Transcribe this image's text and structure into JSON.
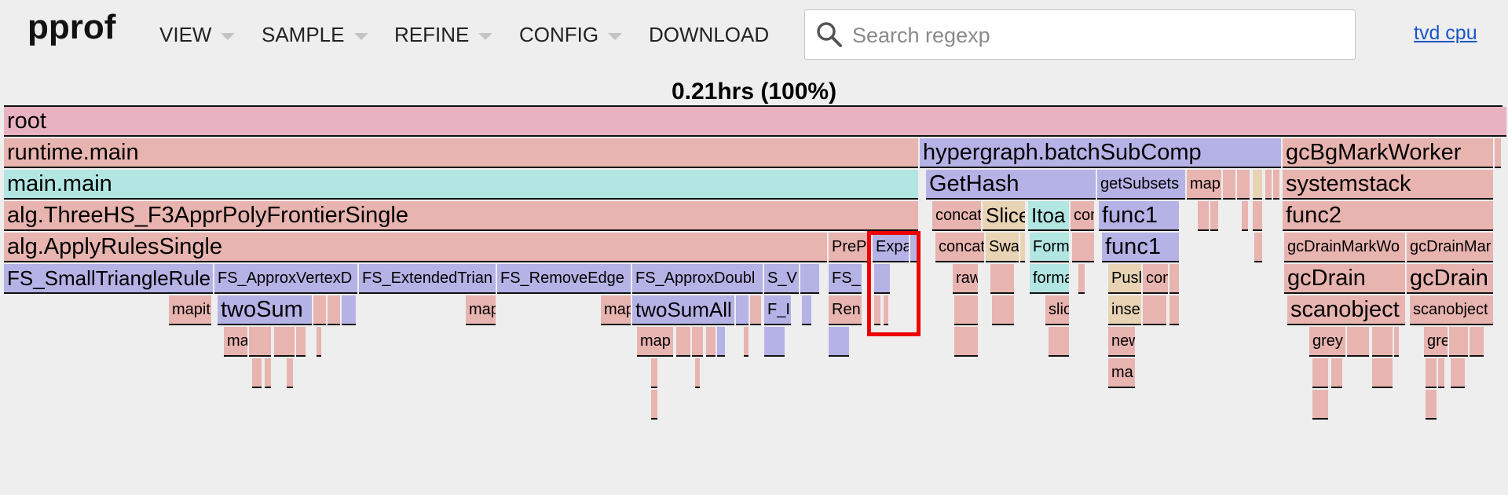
{
  "header": {
    "logo": "pprof",
    "menus": [
      {
        "label": "VIEW"
      },
      {
        "label": "SAMPLE"
      },
      {
        "label": "REFINE"
      },
      {
        "label": "CONFIG"
      },
      {
        "label": "DOWNLOAD"
      }
    ],
    "search": {
      "placeholder": "Search regexp",
      "value": ""
    },
    "user_link": "tvd cpu"
  },
  "flamegraph": {
    "total_label": "0.21hrs (100%)",
    "colors": {
      "pink": "#e8b2c0",
      "salmon": "#e8b4b0",
      "cyan": "#b2e6e2",
      "purple": "#b5b2e6",
      "tan": "#e8d4b4"
    },
    "frames": [
      {
        "label": "root",
        "row": 0,
        "start": 0,
        "end": 1913,
        "color": "pink",
        "size": "big"
      },
      {
        "label": "runtime.main",
        "row": 1,
        "start": 0,
        "end": 1164,
        "color": "salmon",
        "size": "big"
      },
      {
        "label": "hypergraph.batchSubComp",
        "row": 1,
        "start": 1166,
        "end": 1626,
        "color": "purple",
        "size": "big"
      },
      {
        "label": "gcBgMarkWorker",
        "row": 1,
        "start": 1628,
        "end": 1896,
        "color": "salmon",
        "size": "big"
      },
      {
        "label": "",
        "row": 1,
        "start": 1898,
        "end": 1906,
        "color": "salmon",
        "size": "big"
      },
      {
        "label": "main.main",
        "row": 2,
        "start": 0,
        "end": 1164,
        "color": "cyan",
        "size": "big"
      },
      {
        "label": "GetHash",
        "row": 2,
        "start": 1174,
        "end": 1390,
        "color": "purple",
        "size": "big"
      },
      {
        "label": "getSubsets",
        "row": 2,
        "start": 1392,
        "end": 1504,
        "color": "purple",
        "size": "small"
      },
      {
        "label": "map",
        "row": 2,
        "start": 1506,
        "end": 1550,
        "color": "salmon",
        "size": "small"
      },
      {
        "label": "",
        "row": 2,
        "start": 1552,
        "end": 1568,
        "color": "salmon",
        "size": "small"
      },
      {
        "label": "",
        "row": 2,
        "start": 1570,
        "end": 1586,
        "color": "salmon",
        "size": "small"
      },
      {
        "label": "",
        "row": 2,
        "start": 1590,
        "end": 1602,
        "color": "tan",
        "size": "small"
      },
      {
        "label": "",
        "row": 2,
        "start": 1606,
        "end": 1614,
        "color": "salmon",
        "size": "small"
      },
      {
        "label": "",
        "row": 2,
        "start": 1616,
        "end": 1624,
        "color": "salmon",
        "size": "small"
      },
      {
        "label": "systemstack",
        "row": 2,
        "start": 1628,
        "end": 1896,
        "color": "salmon",
        "size": "big"
      },
      {
        "label": "alg.ThreeHS_F3ApprPolyFrontierSingle",
        "row": 3,
        "start": 0,
        "end": 1164,
        "color": "salmon",
        "size": "big"
      },
      {
        "label": "concat",
        "row": 3,
        "start": 1182,
        "end": 1244,
        "color": "salmon",
        "size": "small"
      },
      {
        "label": "Slice",
        "row": 3,
        "start": 1246,
        "end": 1300,
        "color": "tan",
        "size": "mid"
      },
      {
        "label": "Itoa",
        "row": 3,
        "start": 1304,
        "end": 1356,
        "color": "cyan",
        "size": "mid"
      },
      {
        "label": "con",
        "row": 3,
        "start": 1358,
        "end": 1388,
        "color": "salmon",
        "size": "small"
      },
      {
        "label": "func1",
        "row": 3,
        "start": 1394,
        "end": 1496,
        "color": "purple",
        "size": "big"
      },
      {
        "label": "",
        "row": 3,
        "start": 1520,
        "end": 1534,
        "color": "salmon",
        "size": "small"
      },
      {
        "label": "",
        "row": 3,
        "start": 1536,
        "end": 1546,
        "color": "salmon",
        "size": "small"
      },
      {
        "label": "",
        "row": 3,
        "start": 1576,
        "end": 1584,
        "color": "salmon",
        "size": "small"
      },
      {
        "label": "",
        "row": 3,
        "start": 1590,
        "end": 1602,
        "color": "salmon",
        "size": "small"
      },
      {
        "label": "func2",
        "row": 3,
        "start": 1628,
        "end": 1896,
        "color": "salmon",
        "size": "big"
      },
      {
        "label": "alg.ApplyRulesSingle",
        "row": 4,
        "start": 0,
        "end": 1048,
        "color": "salmon",
        "size": "big"
      },
      {
        "label": "PreP",
        "row": 4,
        "start": 1050,
        "end": 1104,
        "color": "salmon",
        "size": "small"
      },
      {
        "label": "Expa",
        "row": 4,
        "start": 1106,
        "end": 1152,
        "color": "purple",
        "size": "small"
      },
      {
        "label": "",
        "row": 4,
        "start": 1154,
        "end": 1162,
        "color": "purple",
        "size": "small"
      },
      {
        "label": "concat",
        "row": 4,
        "start": 1186,
        "end": 1248,
        "color": "salmon",
        "size": "small"
      },
      {
        "label": "Swa",
        "row": 4,
        "start": 1250,
        "end": 1292,
        "color": "tan",
        "size": "small"
      },
      {
        "label": "",
        "row": 4,
        "start": 1294,
        "end": 1300,
        "color": "tan",
        "size": "small"
      },
      {
        "label": "Form",
        "row": 4,
        "start": 1306,
        "end": 1356,
        "color": "cyan",
        "size": "small"
      },
      {
        "label": "",
        "row": 4,
        "start": 1360,
        "end": 1388,
        "color": "salmon",
        "size": "small"
      },
      {
        "label": "func1",
        "row": 4,
        "start": 1398,
        "end": 1496,
        "color": "purple",
        "size": "big"
      },
      {
        "label": "",
        "row": 4,
        "start": 1592,
        "end": 1602,
        "color": "salmon",
        "size": "small"
      },
      {
        "label": "gcDrainMarkWo",
        "row": 4,
        "start": 1630,
        "end": 1784,
        "color": "salmon",
        "size": "small"
      },
      {
        "label": "gcDrainMar",
        "row": 4,
        "start": 1786,
        "end": 1896,
        "color": "salmon",
        "size": "small"
      },
      {
        "label": "FS_SmallTriangleRule",
        "row": 5,
        "start": 0,
        "end": 266,
        "color": "purple",
        "size": "mid"
      },
      {
        "label": "FS_ApproxVertexD",
        "row": 5,
        "start": 268,
        "end": 450,
        "color": "purple",
        "size": "small"
      },
      {
        "label": "FS_ExtendedTrian",
        "row": 5,
        "start": 452,
        "end": 626,
        "color": "purple",
        "size": "small"
      },
      {
        "label": "FS_RemoveEdge",
        "row": 5,
        "start": 628,
        "end": 798,
        "color": "purple",
        "size": "small"
      },
      {
        "label": "FS_ApproxDoubl",
        "row": 5,
        "start": 800,
        "end": 966,
        "color": "purple",
        "size": "small"
      },
      {
        "label": "S_V",
        "row": 5,
        "start": 968,
        "end": 1012,
        "color": "purple",
        "size": "small"
      },
      {
        "label": "",
        "row": 5,
        "start": 1014,
        "end": 1038,
        "color": "purple",
        "size": "small"
      },
      {
        "label": "FS_",
        "row": 5,
        "start": 1050,
        "end": 1092,
        "color": "purple",
        "size": "small"
      },
      {
        "label": "",
        "row": 5,
        "start": 1108,
        "end": 1128,
        "color": "purple",
        "size": "small"
      },
      {
        "label": "raw",
        "row": 5,
        "start": 1208,
        "end": 1240,
        "color": "salmon",
        "size": "small"
      },
      {
        "label": "",
        "row": 5,
        "start": 1256,
        "end": 1286,
        "color": "salmon",
        "size": "small"
      },
      {
        "label": "forma",
        "row": 5,
        "start": 1306,
        "end": 1356,
        "color": "cyan",
        "size": "small"
      },
      {
        "label": "",
        "row": 5,
        "start": 1368,
        "end": 1376,
        "color": "salmon",
        "size": "small"
      },
      {
        "label": "Push",
        "row": 5,
        "start": 1406,
        "end": 1448,
        "color": "tan",
        "size": "small"
      },
      {
        "label": "con",
        "row": 5,
        "start": 1450,
        "end": 1482,
        "color": "salmon",
        "size": "small"
      },
      {
        "label": "",
        "row": 5,
        "start": 1484,
        "end": 1496,
        "color": "salmon",
        "size": "small"
      },
      {
        "label": "gcDrain",
        "row": 5,
        "start": 1630,
        "end": 1784,
        "color": "salmon",
        "size": "big"
      },
      {
        "label": "gcDrain",
        "row": 5,
        "start": 1786,
        "end": 1896,
        "color": "salmon",
        "size": "big"
      },
      {
        "label": "mapit",
        "row": 6,
        "start": 210,
        "end": 264,
        "color": "salmon",
        "size": "small"
      },
      {
        "label": "twoSum",
        "row": 6,
        "start": 272,
        "end": 392,
        "color": "purple",
        "size": "big"
      },
      {
        "label": "",
        "row": 6,
        "start": 394,
        "end": 410,
        "color": "salmon",
        "size": "small"
      },
      {
        "label": "",
        "row": 6,
        "start": 412,
        "end": 428,
        "color": "salmon",
        "size": "small"
      },
      {
        "label": "",
        "row": 6,
        "start": 430,
        "end": 448,
        "color": "purple",
        "size": "small"
      },
      {
        "label": "map",
        "row": 6,
        "start": 588,
        "end": 626,
        "color": "salmon",
        "size": "small"
      },
      {
        "label": "map",
        "row": 6,
        "start": 760,
        "end": 798,
        "color": "salmon",
        "size": "small"
      },
      {
        "label": "twoSumAll",
        "row": 6,
        "start": 800,
        "end": 930,
        "color": "purple",
        "size": "mid"
      },
      {
        "label": "",
        "row": 6,
        "start": 932,
        "end": 948,
        "color": "purple",
        "size": "small"
      },
      {
        "label": "",
        "row": 6,
        "start": 950,
        "end": 964,
        "color": "salmon",
        "size": "small"
      },
      {
        "label": "F_I",
        "row": 6,
        "start": 968,
        "end": 1002,
        "color": "purple",
        "size": "small"
      },
      {
        "label": "",
        "row": 6,
        "start": 1016,
        "end": 1028,
        "color": "purple",
        "size": "small"
      },
      {
        "label": "Ren",
        "row": 6,
        "start": 1050,
        "end": 1092,
        "color": "salmon",
        "size": "small"
      },
      {
        "label": "",
        "row": 6,
        "start": 1108,
        "end": 1116,
        "color": "salmon",
        "size": "small"
      },
      {
        "label": "",
        "row": 6,
        "start": 1120,
        "end": 1126,
        "color": "salmon",
        "size": "small"
      },
      {
        "label": "",
        "row": 6,
        "start": 1210,
        "end": 1240,
        "color": "salmon",
        "size": "small"
      },
      {
        "label": "",
        "row": 6,
        "start": 1258,
        "end": 1286,
        "color": "salmon",
        "size": "small"
      },
      {
        "label": "slic",
        "row": 6,
        "start": 1326,
        "end": 1356,
        "color": "salmon",
        "size": "small"
      },
      {
        "label": "inse",
        "row": 6,
        "start": 1406,
        "end": 1448,
        "color": "tan",
        "size": "small"
      },
      {
        "label": "",
        "row": 6,
        "start": 1450,
        "end": 1480,
        "color": "salmon",
        "size": "small"
      },
      {
        "label": "",
        "row": 6,
        "start": 1484,
        "end": 1496,
        "color": "salmon",
        "size": "small"
      },
      {
        "label": "scanobject",
        "row": 6,
        "start": 1634,
        "end": 1784,
        "color": "salmon",
        "size": "big"
      },
      {
        "label": "scanobject",
        "row": 6,
        "start": 1790,
        "end": 1896,
        "color": "salmon",
        "size": "small"
      },
      {
        "label": "ma",
        "row": 7,
        "start": 280,
        "end": 310,
        "color": "salmon",
        "size": "small"
      },
      {
        "label": "",
        "row": 7,
        "start": 312,
        "end": 340,
        "color": "salmon",
        "size": "small"
      },
      {
        "label": "",
        "row": 7,
        "start": 344,
        "end": 370,
        "color": "salmon",
        "size": "small"
      },
      {
        "label": "",
        "row": 7,
        "start": 372,
        "end": 384,
        "color": "salmon",
        "size": "small"
      },
      {
        "label": "",
        "row": 7,
        "start": 398,
        "end": 404,
        "color": "salmon",
        "size": "small"
      },
      {
        "label": "map",
        "row": 7,
        "start": 806,
        "end": 852,
        "color": "salmon",
        "size": "small"
      },
      {
        "label": "",
        "row": 7,
        "start": 856,
        "end": 874,
        "color": "salmon",
        "size": "small"
      },
      {
        "label": "",
        "row": 7,
        "start": 876,
        "end": 890,
        "color": "salmon",
        "size": "small"
      },
      {
        "label": "",
        "row": 7,
        "start": 894,
        "end": 906,
        "color": "salmon",
        "size": "small"
      },
      {
        "label": "",
        "row": 7,
        "start": 908,
        "end": 918,
        "color": "purple",
        "size": "small"
      },
      {
        "label": "",
        "row": 7,
        "start": 942,
        "end": 948,
        "color": "salmon",
        "size": "small"
      },
      {
        "label": "",
        "row": 7,
        "start": 968,
        "end": 994,
        "color": "purple",
        "size": "small"
      },
      {
        "label": "",
        "row": 7,
        "start": 1050,
        "end": 1076,
        "color": "purple",
        "size": "small"
      },
      {
        "label": "",
        "row": 7,
        "start": 1210,
        "end": 1240,
        "color": "salmon",
        "size": "small"
      },
      {
        "label": "",
        "row": 7,
        "start": 1330,
        "end": 1356,
        "color": "salmon",
        "size": "small"
      },
      {
        "label": "new",
        "row": 7,
        "start": 1406,
        "end": 1440,
        "color": "salmon",
        "size": "small"
      },
      {
        "label": "grey",
        "row": 7,
        "start": 1662,
        "end": 1708,
        "color": "salmon",
        "size": "small"
      },
      {
        "label": "",
        "row": 7,
        "start": 1710,
        "end": 1738,
        "color": "salmon",
        "size": "small"
      },
      {
        "label": "",
        "row": 7,
        "start": 1742,
        "end": 1768,
        "color": "salmon",
        "size": "small"
      },
      {
        "label": "",
        "row": 7,
        "start": 1770,
        "end": 1776,
        "color": "salmon",
        "size": "small"
      },
      {
        "label": "gre",
        "row": 7,
        "start": 1808,
        "end": 1838,
        "color": "salmon",
        "size": "small"
      },
      {
        "label": "",
        "row": 7,
        "start": 1840,
        "end": 1864,
        "color": "salmon",
        "size": "small"
      },
      {
        "label": "",
        "row": 7,
        "start": 1866,
        "end": 1884,
        "color": "salmon",
        "size": "small"
      },
      {
        "label": "",
        "row": 8,
        "start": 316,
        "end": 328,
        "color": "salmon",
        "size": "small"
      },
      {
        "label": "",
        "row": 8,
        "start": 332,
        "end": 340,
        "color": "salmon",
        "size": "small"
      },
      {
        "label": "",
        "row": 8,
        "start": 360,
        "end": 368,
        "color": "salmon",
        "size": "small"
      },
      {
        "label": "",
        "row": 8,
        "start": 824,
        "end": 832,
        "color": "salmon",
        "size": "small"
      },
      {
        "label": "",
        "row": 8,
        "start": 880,
        "end": 886,
        "color": "salmon",
        "size": "small"
      },
      {
        "label": "ma",
        "row": 8,
        "start": 1406,
        "end": 1440,
        "color": "salmon",
        "size": "small"
      },
      {
        "label": "",
        "row": 8,
        "start": 1666,
        "end": 1686,
        "color": "salmon",
        "size": "small"
      },
      {
        "label": "",
        "row": 8,
        "start": 1690,
        "end": 1704,
        "color": "salmon",
        "size": "small"
      },
      {
        "label": "",
        "row": 8,
        "start": 1742,
        "end": 1768,
        "color": "salmon",
        "size": "small"
      },
      {
        "label": "",
        "row": 8,
        "start": 1810,
        "end": 1824,
        "color": "salmon",
        "size": "small"
      },
      {
        "label": "",
        "row": 8,
        "start": 1826,
        "end": 1834,
        "color": "salmon",
        "size": "small"
      },
      {
        "label": "",
        "row": 8,
        "start": 1842,
        "end": 1860,
        "color": "salmon",
        "size": "small"
      },
      {
        "label": "",
        "row": 9,
        "start": 824,
        "end": 832,
        "color": "salmon",
        "size": "small"
      },
      {
        "label": "",
        "row": 9,
        "start": 1666,
        "end": 1686,
        "color": "salmon",
        "size": "small"
      },
      {
        "label": "",
        "row": 9,
        "start": 1810,
        "end": 1824,
        "color": "salmon",
        "size": "small"
      }
    ]
  }
}
